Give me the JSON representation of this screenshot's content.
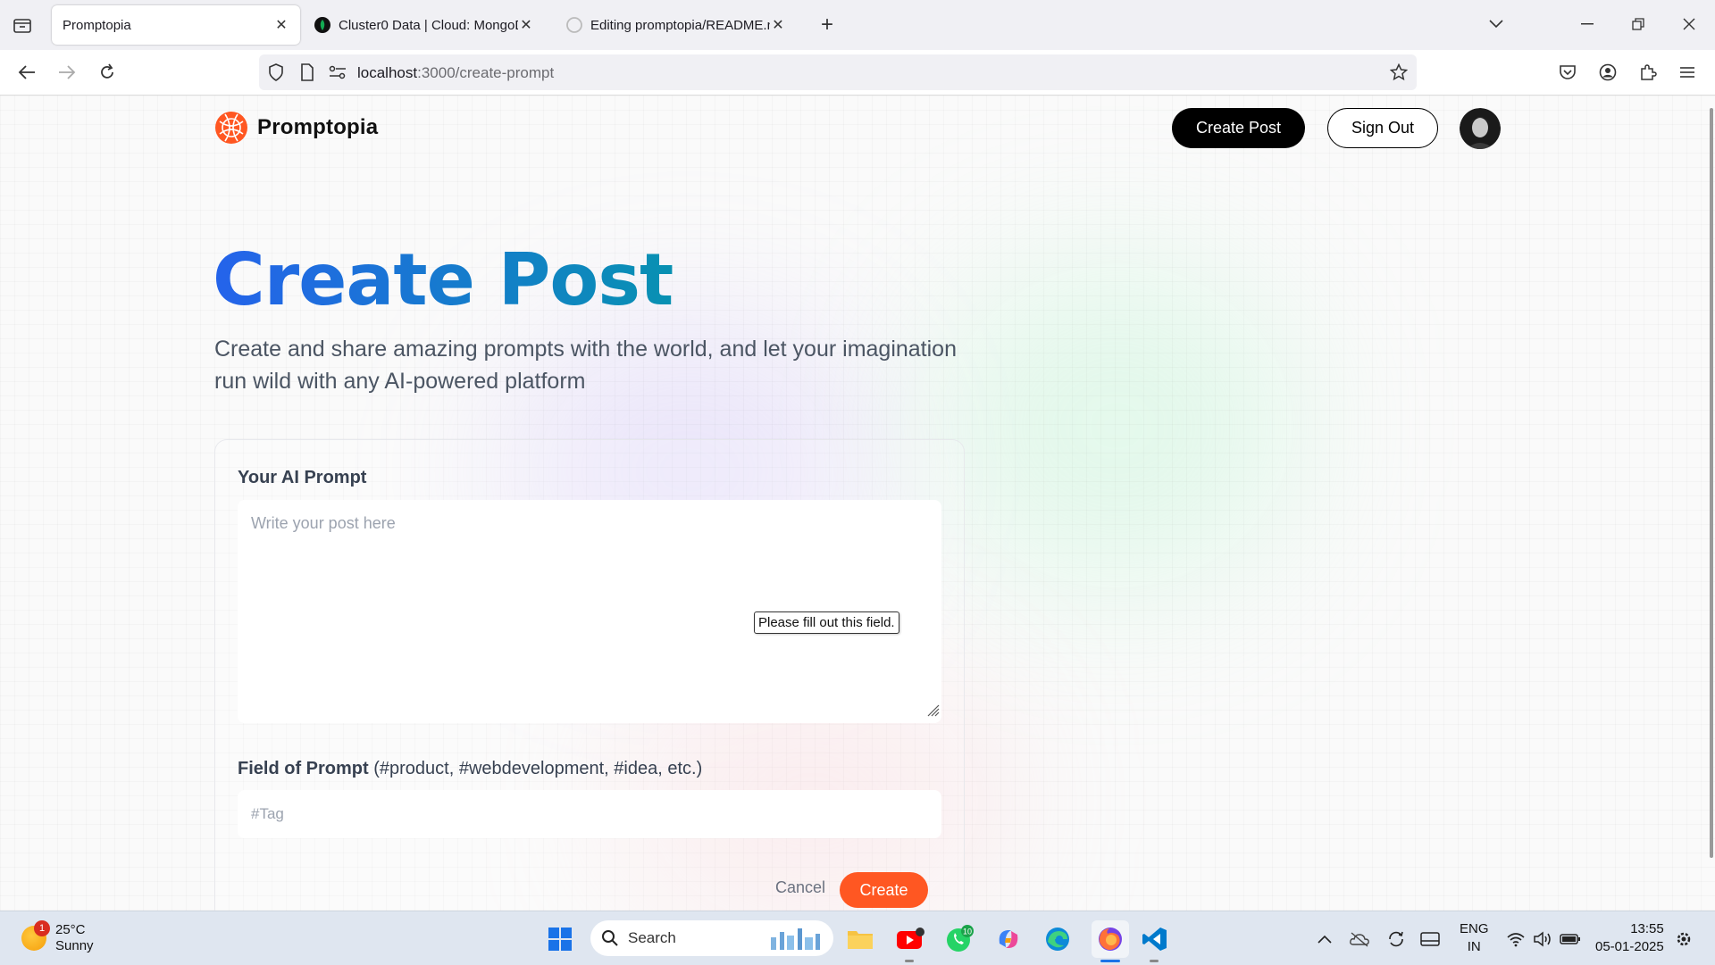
{
  "browser": {
    "tabs": [
      {
        "title": "Promptopia",
        "icon": "page-icon",
        "active": true
      },
      {
        "title": "Cluster0 Data | Cloud: MongoD",
        "icon": "mongodb-leaf-icon",
        "active": false
      },
      {
        "title": "Editing promptopia/README.n",
        "icon": "github-icon",
        "active": false
      }
    ],
    "url_host": "localhost",
    "url_path": ":3000/create-prompt"
  },
  "app": {
    "brand": "Promptopia",
    "nav": {
      "create_post": "Create Post",
      "sign_out": "Sign Out"
    },
    "headline": "Create Post",
    "description": "Create and share amazing prompts with the world, and let your imagination run wild with any AI-powered platform",
    "form": {
      "prompt_label": "Your AI Prompt",
      "prompt_placeholder": "Write your post here",
      "validation_tooltip": "Please fill out this field.",
      "tag_label": "Field of Prompt",
      "tag_hint": "(#product, #webdevelopment, #idea, etc.)",
      "tag_placeholder": "#Tag",
      "cancel": "Cancel",
      "submit": "Create"
    },
    "colors": {
      "accent": "#ff5722",
      "gradient_start": "#2563eb",
      "gradient_end": "#0891b2"
    }
  },
  "taskbar": {
    "weather_temp": "25°C",
    "weather_text": "Sunny",
    "weather_badge": "1",
    "search_label": "Search",
    "whatsapp_badge": "10",
    "lang_line1": "ENG",
    "lang_line2": "IN",
    "time": "13:55",
    "date": "05-01-2025"
  }
}
